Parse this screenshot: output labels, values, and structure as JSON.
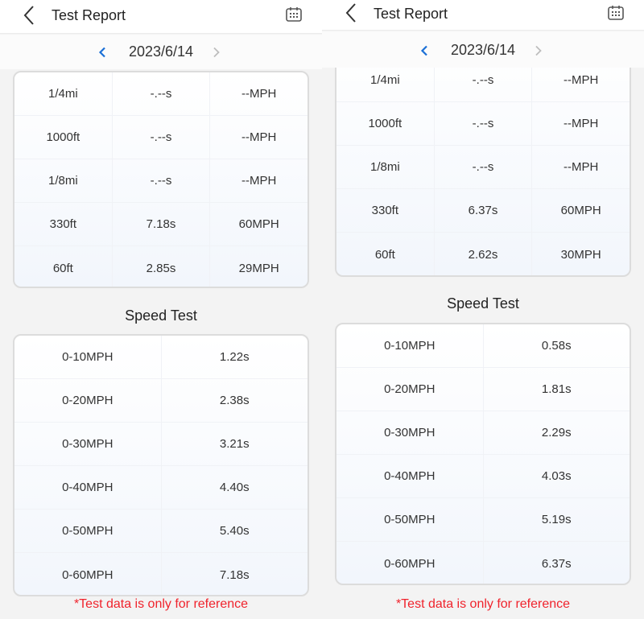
{
  "panels": [
    {
      "header": {
        "title": "Test Report",
        "back_icon": "chevron-left-icon",
        "calendar_icon": "calendar-icon"
      },
      "date_nav": {
        "date": "2023/6/14",
        "prev_icon": "chevron-left-icon",
        "next_icon": "chevron-right-icon"
      },
      "distance_table": {
        "rows": [
          [
            "1/4mi",
            "-.--s",
            "--MPH"
          ],
          [
            "1000ft",
            "-.--s",
            "--MPH"
          ],
          [
            "1/8mi",
            "-.--s",
            "--MPH"
          ],
          [
            "330ft",
            "7.18s",
            "60MPH"
          ],
          [
            "60ft",
            "2.85s",
            "29MPH"
          ]
        ]
      },
      "speed_test": {
        "title": "Speed Test",
        "rows": [
          [
            "0-10MPH",
            "1.22s"
          ],
          [
            "0-20MPH",
            "2.38s"
          ],
          [
            "0-30MPH",
            "3.21s"
          ],
          [
            "0-40MPH",
            "4.40s"
          ],
          [
            "0-50MPH",
            "5.40s"
          ],
          [
            "0-60MPH",
            "7.18s"
          ]
        ]
      },
      "disclaimer": "*Test data is only for reference"
    },
    {
      "header": {
        "title": "Test Report",
        "back_icon": "chevron-left-icon",
        "calendar_icon": "calendar-icon"
      },
      "date_nav": {
        "date": "2023/6/14",
        "prev_icon": "chevron-left-icon",
        "next_icon": "chevron-right-icon"
      },
      "distance_table": {
        "rows": [
          [
            "1/4mi",
            "-.--s",
            "--MPH"
          ],
          [
            "1000ft",
            "-.--s",
            "--MPH"
          ],
          [
            "1/8mi",
            "-.--s",
            "--MPH"
          ],
          [
            "330ft",
            "6.37s",
            "60MPH"
          ],
          [
            "60ft",
            "2.62s",
            "30MPH"
          ]
        ]
      },
      "speed_test": {
        "title": "Speed Test",
        "rows": [
          [
            "0-10MPH",
            "0.58s"
          ],
          [
            "0-20MPH",
            "1.81s"
          ],
          [
            "0-30MPH",
            "2.29s"
          ],
          [
            "0-40MPH",
            "4.03s"
          ],
          [
            "0-50MPH",
            "5.19s"
          ],
          [
            "0-60MPH",
            "6.37s"
          ]
        ]
      },
      "disclaimer": "*Test data is only for reference"
    }
  ],
  "colors": {
    "accent": "#1a6fd6",
    "disabled": "#bdbdbd",
    "warning": "#f0232c"
  }
}
